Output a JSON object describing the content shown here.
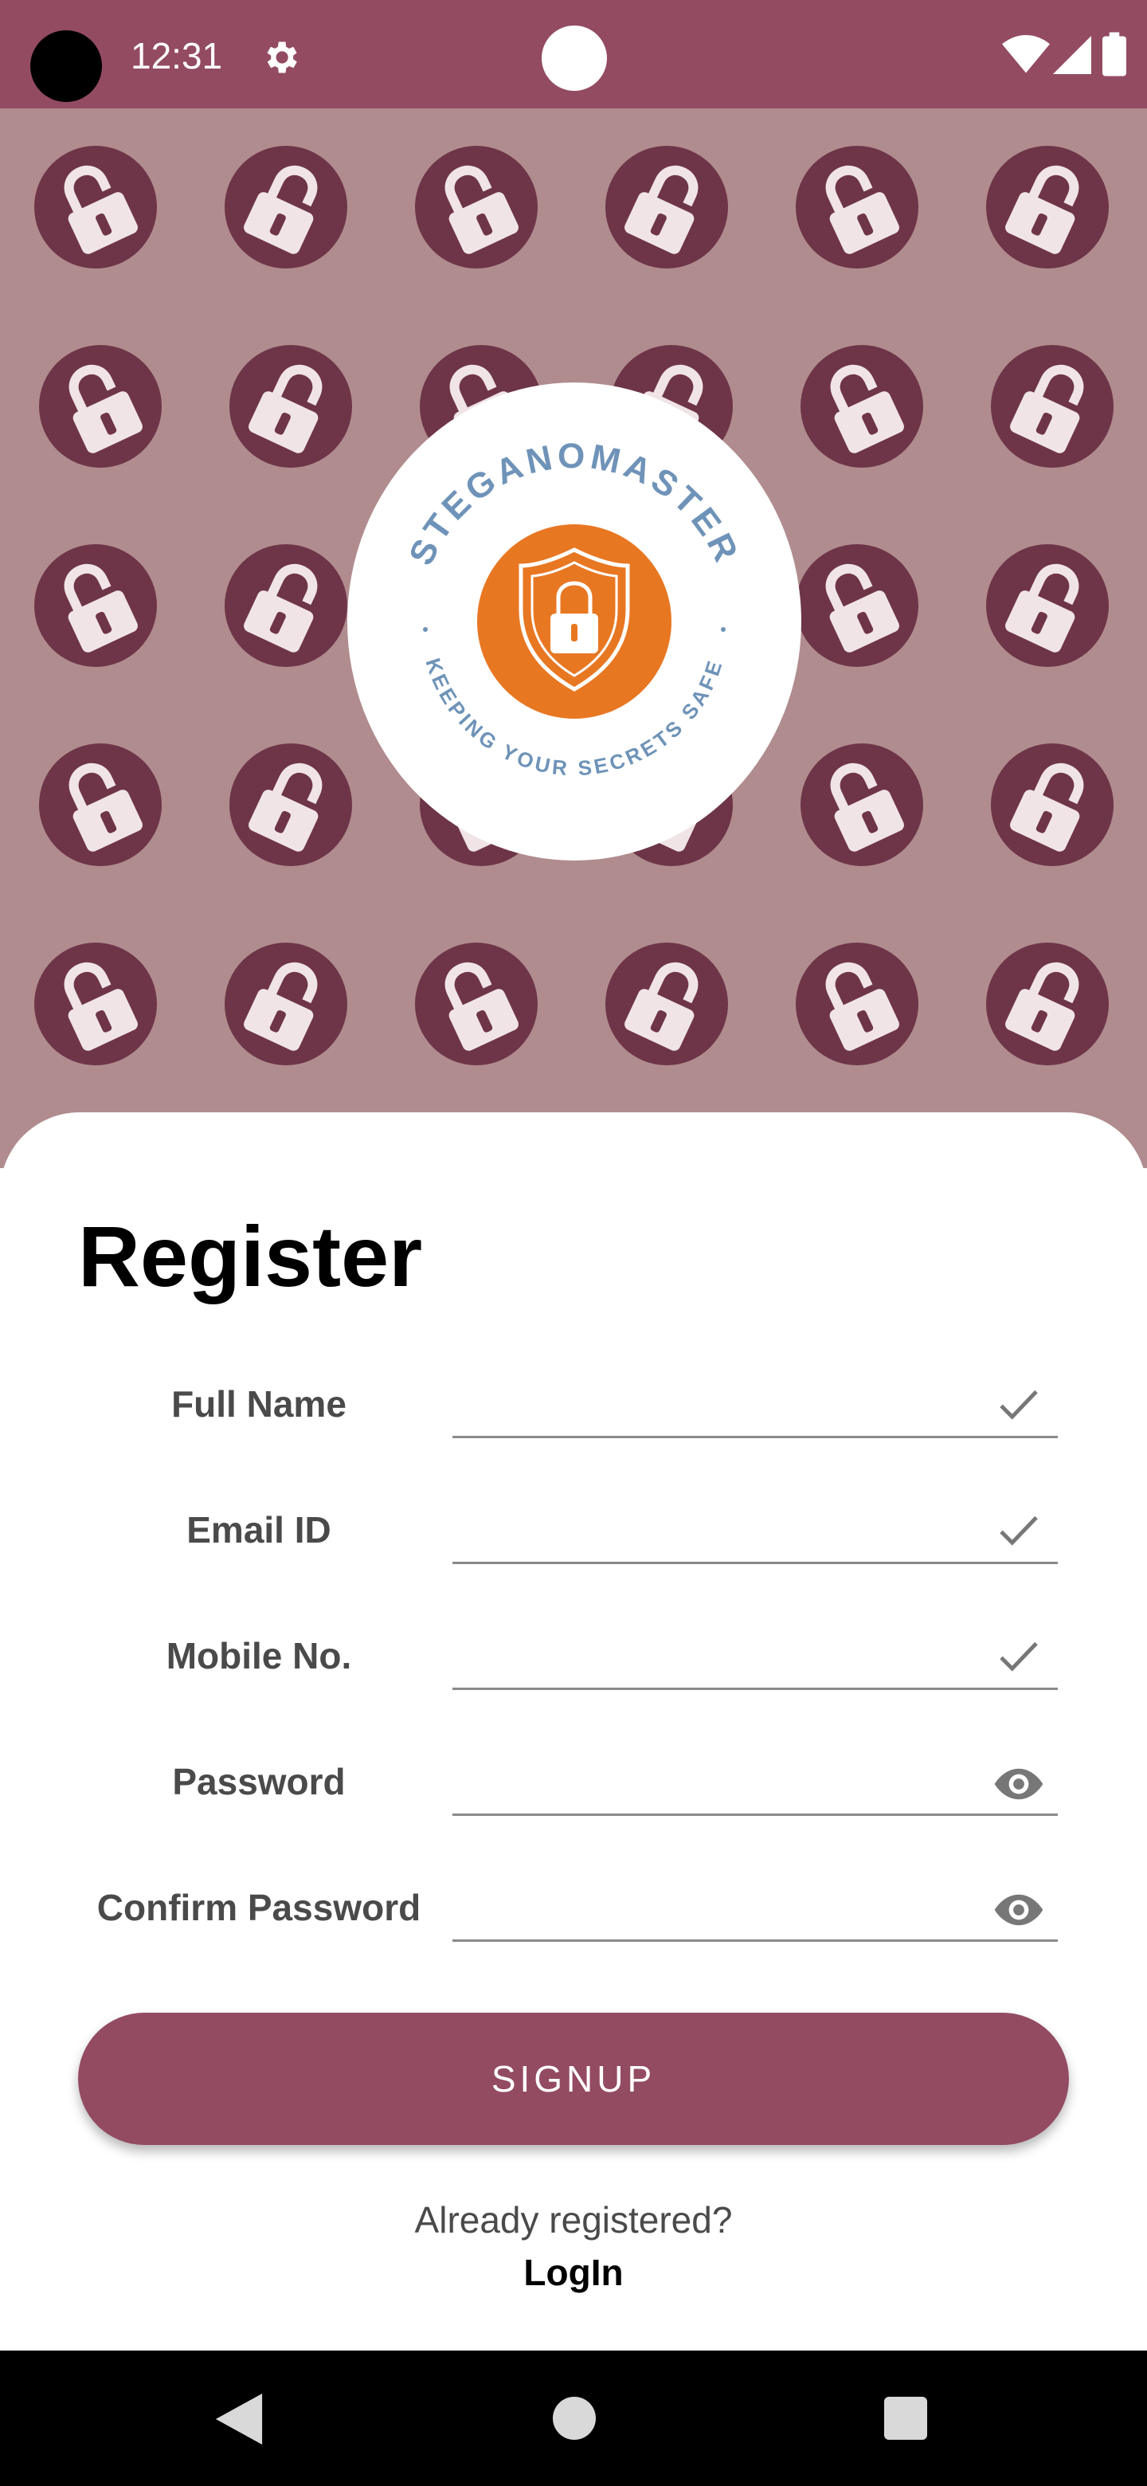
{
  "status_bar": {
    "time": "12:31",
    "icons": [
      "camera-cutout",
      "gear-icon",
      "notification-dot",
      "wifi-icon",
      "signal-icon",
      "battery-icon"
    ],
    "background": "#934b62"
  },
  "hero": {
    "background": "#b08c8e",
    "pattern_icon": "padlock-badge",
    "pattern_color": "#6e3548",
    "logo": {
      "top_text": "STEGANOMASTER",
      "bottom_text": "KEEPING YOUR SECRETS SAFE",
      "center_icon": "shield-lock-icon",
      "accent": "#e87722",
      "text_color": "#6f93b8"
    }
  },
  "form": {
    "title": "Register",
    "fields": [
      {
        "label": "Full Name",
        "value": "",
        "icon": "check-icon"
      },
      {
        "label": "Email ID",
        "value": "",
        "icon": "check-icon"
      },
      {
        "label": "Mobile No.",
        "value": "",
        "icon": "check-icon"
      },
      {
        "label": "Password",
        "value": "",
        "icon": "eye-icon"
      },
      {
        "label": "Confirm Password",
        "value": "",
        "icon": "eye-icon"
      }
    ],
    "signup_label": "SIGNUP",
    "already_text": "Already registered?",
    "login_label": "LogIn"
  },
  "nav_bar": {
    "icons": [
      "back-icon",
      "home-icon",
      "recents-icon"
    ]
  },
  "colors": {
    "primary": "#934b62",
    "label": "#4a4a4a",
    "underline": "#8a8a8a"
  }
}
